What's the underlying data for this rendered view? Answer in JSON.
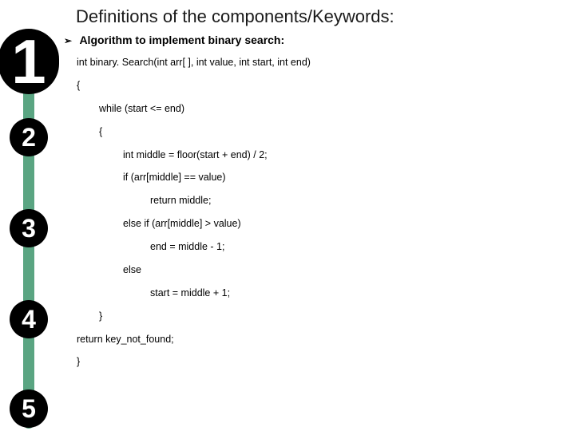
{
  "title": "Definitions of the components/Keywords:",
  "heading": "Algorithm to implement binary search:",
  "balls": {
    "b1": "1",
    "b2": "2",
    "b3": "3",
    "b4": "4",
    "b5": "5"
  },
  "code": {
    "l1": "int binary. Search(int arr[ ], int value, int start, int end)",
    "l2": "{",
    "l3": "while (start <= end)",
    "l4": "{",
    "l5": "int middle = floor(start + end) / 2;",
    "l6": "if (arr[middle] == value)",
    "l7": "return middle;",
    "l8": "else if (arr[middle] > value)",
    "l9": "end = middle - 1;",
    "l10": "else",
    "l11": "start = middle + 1;",
    "l12": "}",
    "l13": "return key_not_found;",
    "l14": "}"
  }
}
